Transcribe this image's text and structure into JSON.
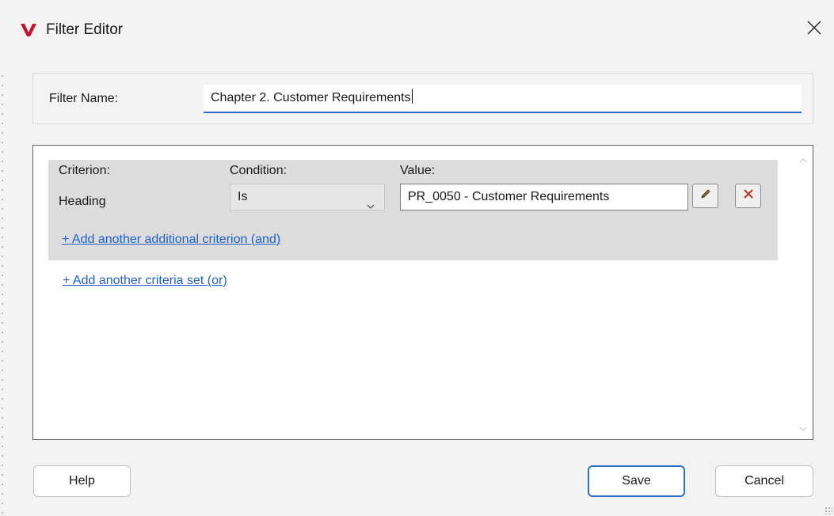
{
  "window": {
    "title": "Filter Editor",
    "logo_icon": "vault-v-logo-icon",
    "close_icon": "close-icon"
  },
  "filter_name": {
    "label": "Filter Name:",
    "value": "Chapter 2. Customer Requirements"
  },
  "criteria_set": {
    "headers": {
      "criterion": "Criterion:",
      "condition": "Condition:",
      "value": "Value:"
    },
    "rows": [
      {
        "criterion": "Heading",
        "condition": "Is",
        "value": "PR_0050 - Customer Requirements",
        "edit_icon": "pencil-icon",
        "delete_icon": "delete-x-icon"
      }
    ],
    "add_and_link": "+ Add another additional criterion (and)"
  },
  "add_or_link": "+ Add another criteria set (or)",
  "buttons": {
    "help": "Help",
    "save": "Save",
    "cancel": "Cancel"
  },
  "colors": {
    "accent": "#2f6fc3",
    "link": "#2060c8",
    "logo_red": "#c8102e",
    "delete_red": "#c0392b"
  }
}
